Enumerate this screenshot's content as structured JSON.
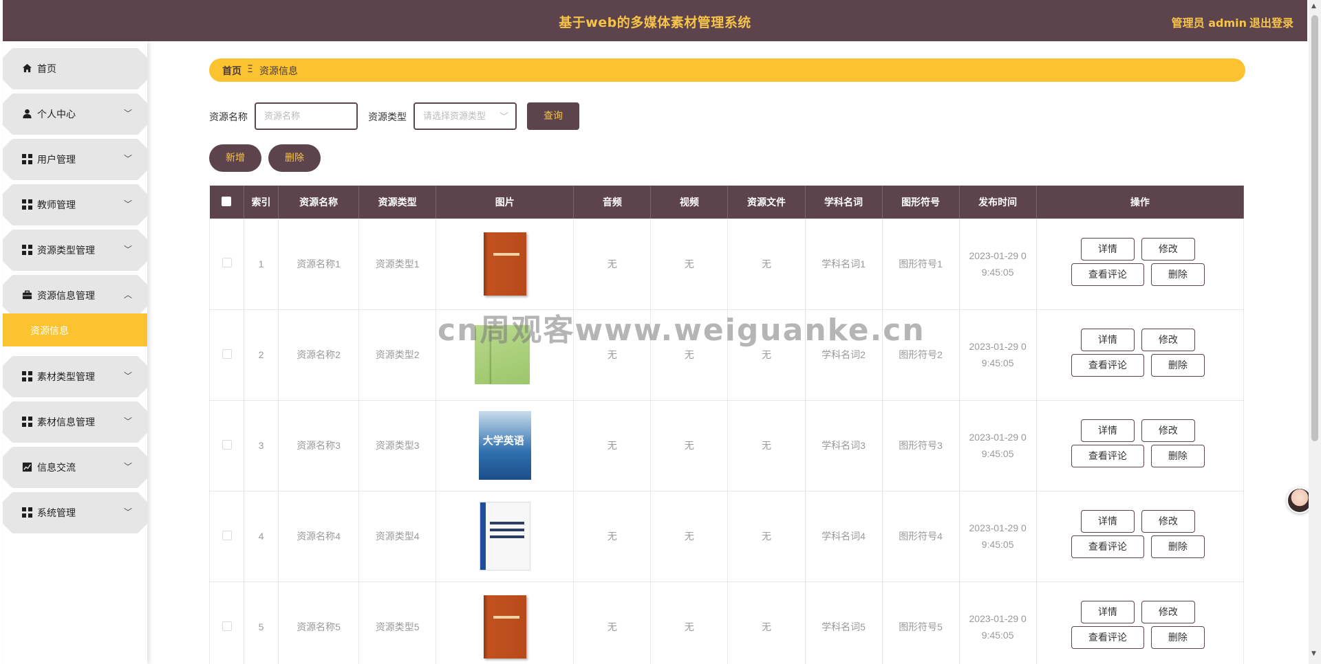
{
  "header": {
    "title": "基于web的多媒体素材管理系统",
    "user": "管理员 admin",
    "logout": "退出登录"
  },
  "sidebar": {
    "items": [
      {
        "label": "首页",
        "icon": "home-icon"
      },
      {
        "label": "个人中心",
        "icon": "user-icon"
      },
      {
        "label": "用户管理",
        "icon": "grid-icon"
      },
      {
        "label": "教师管理",
        "icon": "grid-icon"
      },
      {
        "label": "资源类型管理",
        "icon": "grid-icon"
      },
      {
        "label": "资源信息管理",
        "icon": "briefcase-icon"
      },
      {
        "label": "素材类型管理",
        "icon": "grid-icon"
      },
      {
        "label": "素材信息管理",
        "icon": "grid-icon"
      },
      {
        "label": "信息交流",
        "icon": "chart-icon"
      },
      {
        "label": "系统管理",
        "icon": "grid-icon"
      }
    ],
    "sub_item": "资源信息"
  },
  "breadcrumb": {
    "home": "首页",
    "separator": "Ξ",
    "current": "资源信息"
  },
  "search": {
    "name_label": "资源名称",
    "name_placeholder": "资源名称",
    "type_label": "资源类型",
    "type_placeholder": "请选择资源类型",
    "query_button": "查询"
  },
  "actions": {
    "add": "新增",
    "delete": "删除"
  },
  "table": {
    "columns": [
      "索引",
      "资源名称",
      "资源类型",
      "图片",
      "音频",
      "视频",
      "资源文件",
      "学科名词",
      "图形符号",
      "发布时间",
      "操作"
    ],
    "rows": [
      {
        "index": "1",
        "name": "资源名称1",
        "type": "资源类型1",
        "audio": "无",
        "video": "无",
        "file": "无",
        "term": "学科名词1",
        "symbol": "图形符号1",
        "time_line1": "2023-01-29 0",
        "time_line2": "9:45:05",
        "cover": "orange-book"
      },
      {
        "index": "2",
        "name": "资源名称2",
        "type": "资源类型2",
        "audio": "无",
        "video": "无",
        "file": "无",
        "term": "学科名词2",
        "symbol": "图形符号2",
        "time_line1": "2023-01-29 0",
        "time_line2": "9:45:05",
        "cover": "green-books"
      },
      {
        "index": "3",
        "name": "资源名称3",
        "type": "资源类型3",
        "audio": "无",
        "video": "无",
        "file": "无",
        "term": "学科名词3",
        "symbol": "图形符号3",
        "time_line1": "2023-01-29 0",
        "time_line2": "9:45:05",
        "cover": "blue-book",
        "cover_text": "大学英语"
      },
      {
        "index": "4",
        "name": "资源名称4",
        "type": "资源类型4",
        "audio": "无",
        "video": "无",
        "file": "无",
        "term": "学科名词4",
        "symbol": "图形符号4",
        "time_line1": "2023-01-29 0",
        "time_line2": "9:45:05",
        "cover": "white-book"
      },
      {
        "index": "5",
        "name": "资源名称5",
        "type": "资源类型5",
        "audio": "无",
        "video": "无",
        "file": "无",
        "term": "学科名词5",
        "symbol": "图形符号5",
        "time_line1": "2023-01-29 0",
        "time_line2": "9:45:05",
        "cover": "orange-book"
      }
    ],
    "row_buttons": {
      "detail": "详情",
      "edit": "修改",
      "comment": "查看评论",
      "delete": "删除"
    }
  },
  "watermark": "cn周观客www.weiguanke.cn",
  "colors": {
    "primary": "#5d434b",
    "accent": "#fbc32f",
    "accent_text": "#f6c44a"
  }
}
